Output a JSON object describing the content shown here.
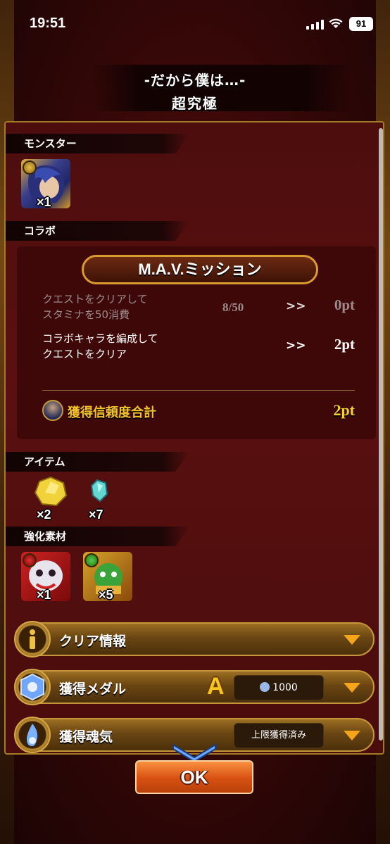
{
  "status_bar": {
    "time": "19:51",
    "battery": "91"
  },
  "header": {
    "title_line1": "-だから僕は…-",
    "title_line2": "超究極"
  },
  "sections": {
    "monster": "モンスター",
    "collab": "コラボ",
    "items": "アイテム",
    "enhance": "強化素材"
  },
  "monster": {
    "count": "×1"
  },
  "collab": {
    "mission_button": "M.A.V.ミッション",
    "missions": [
      {
        "text_line1": "クエストをクリアして",
        "text_line2": "スタミナを50消費",
        "progress": "8/50",
        "arrow": ">>",
        "points": "0pt"
      },
      {
        "text_line1": "コラボキャラを編成して",
        "text_line2": "クエストをクリア",
        "progress": "",
        "arrow": ">>",
        "points": "2pt"
      }
    ],
    "total_label": "獲得信頼度合計",
    "total_value": "2pt"
  },
  "items": [
    {
      "icon": "yellow-crystal",
      "count": "×2"
    },
    {
      "icon": "blue-crystal",
      "count": "×7"
    }
  ],
  "enhance": [
    {
      "icon": "white-monster",
      "count": "×1"
    },
    {
      "icon": "green-monster",
      "count": "×5"
    }
  ],
  "bars": {
    "clear_info": "クリア情報",
    "medal": {
      "label": "獲得メダル",
      "rank": "A",
      "value": "1000"
    },
    "soul": {
      "label": "獲得魂気",
      "status": "上限獲得済み"
    }
  },
  "ok_button": "OK",
  "colors": {
    "gold": "#f4c12a",
    "orange": "#f6a41a",
    "panel": "#4d0d0d"
  }
}
